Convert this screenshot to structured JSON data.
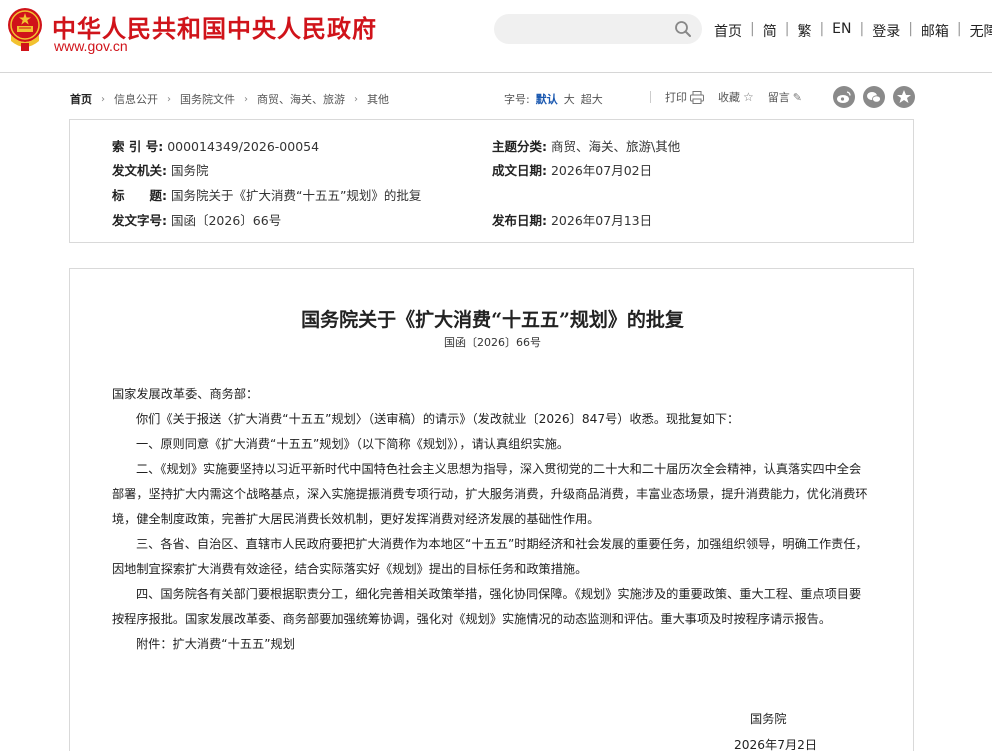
{
  "header": {
    "site_title": "中华人民共和国中央人民政府",
    "site_url": "www.gov.cn",
    "nav_links": [
      "首页",
      "简",
      "繁",
      "EN",
      "登录",
      "邮箱",
      "无障碍"
    ],
    "emblem_colors": {
      "red": "#d0131a",
      "gold": "#f2c230"
    }
  },
  "breadcrumb": {
    "items": [
      "首页",
      "信息公开",
      "国务院文件",
      "商贸、海关、旅游",
      "其他"
    ]
  },
  "font_size": {
    "label": "字号:",
    "options": [
      "默认",
      "大",
      "超大"
    ],
    "selected": "默认"
  },
  "tools": {
    "print": "打印",
    "favorite": "收藏",
    "comment": "留言"
  },
  "share_icons": [
    "weibo-icon",
    "wechat-icon",
    "qzone-icon"
  ],
  "info": {
    "index_label": "索 引 号:",
    "index_value": "000014349/2026-00054",
    "issuer_label": "发文机关:",
    "issuer_value": "国务院",
    "title_label": "标　　题:",
    "title_value": "国务院关于《扩大消费“十五五”规划》的批复",
    "docno_label": "发文字号:",
    "docno_value": "国函〔2026〕66号",
    "topic_label": "主题分类:",
    "topic_value": "商贸、海关、旅游\\其他",
    "written_label": "成文日期:",
    "written_value": "2026年07月02日",
    "published_label": "发布日期:",
    "published_value": "2026年07月13日"
  },
  "article": {
    "title": "国务院关于《扩大消费“十五五”规划》的批复",
    "doc_number": "国函〔2026〕66号",
    "salutation": "国家发展改革委、商务部：",
    "paragraphs": [
      "你们《关于报送〈扩大消费“十五五”规划〉（送审稿）的请示》（发改就业〔2026〕847号）收悉。现批复如下：",
      "一、原则同意《扩大消费“十五五”规划》（以下简称《规划》），请认真组织实施。",
      "二、《规划》实施要坚持以习近平新时代中国特色社会主义思想为指导，深入贯彻党的二十大和二十届历次全会精神，认真落实四中全会部署，坚持扩大内需这个战略基点，深入实施提振消费专项行动，扩大服务消费，升级商品消费，丰富业态场景，提升消费能力，优化消费环境，健全制度政策，完善扩大居民消费长效机制，更好发挥消费对经济发展的基础性作用。",
      "三、各省、自治区、直辖市人民政府要把扩大消费作为本地区“十五五”时期经济和社会发展的重要任务，加强组织领导，明确工作责任，因地制宜探索扩大消费有效途径，结合实际落实好《规划》提出的目标任务和政策措施。",
      "四、国务院各有关部门要根据职责分工，细化完善相关政策举措，强化协同保障。《规划》实施涉及的重要政策、重大工程、重点项目要按程序报批。国家发展改革委、商务部要加强统筹协调，强化对《规划》实施情况的动态监测和评估。重大事项及时按程序请示报告。"
    ],
    "attachment": "附件：扩大消费“十五五”规划",
    "signature_org": "国务院",
    "signature_date": "2026年7月2日"
  }
}
